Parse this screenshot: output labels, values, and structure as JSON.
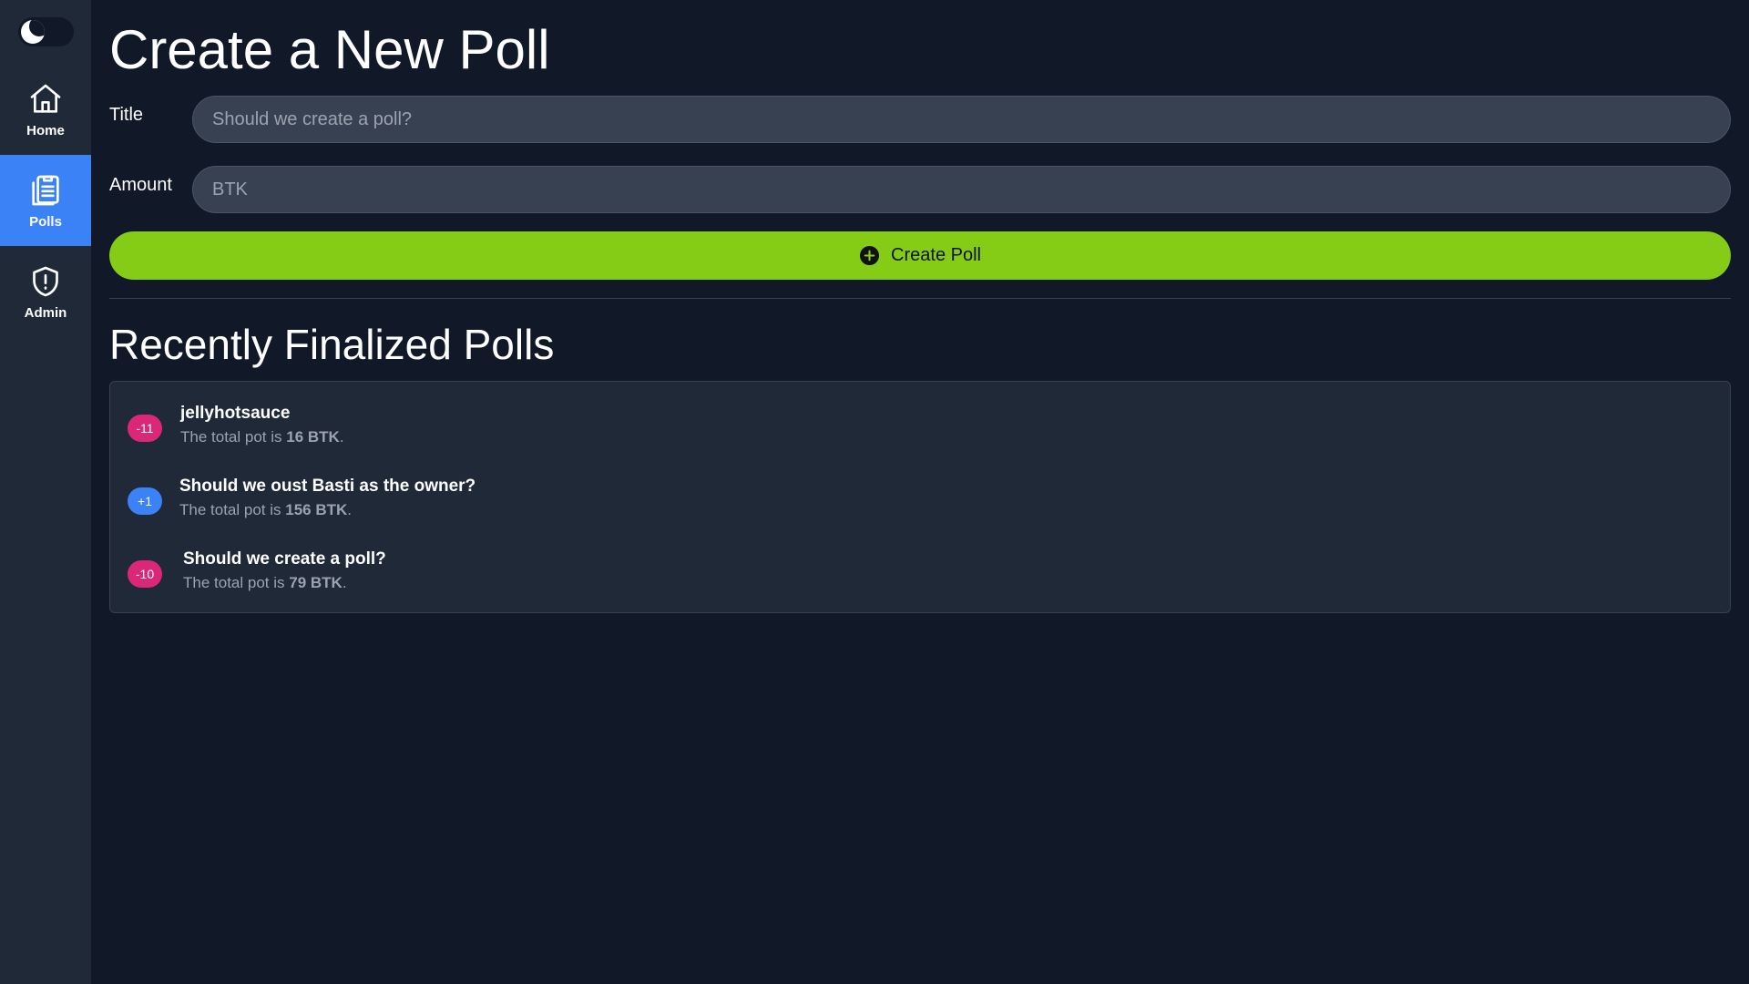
{
  "sidebar": {
    "theme_toggle": {
      "mode": "dark",
      "icon": "moon-icon"
    },
    "items": [
      {
        "label": "Home",
        "icon": "home-icon",
        "active": false
      },
      {
        "label": "Polls",
        "icon": "clipboard-icon",
        "active": true
      },
      {
        "label": "Admin",
        "icon": "shield-alert-icon",
        "active": false
      }
    ]
  },
  "main": {
    "title": "Create a New Poll",
    "form": {
      "title_label": "Title",
      "title_placeholder": "Should we create a poll?",
      "amount_label": "Amount",
      "amount_placeholder": "BTK",
      "submit_label": "Create Poll"
    },
    "recent_title": "Recently Finalized Polls",
    "polls": [
      {
        "badge": "-11",
        "badge_color": "#db2777",
        "title": "jellyhotsauce",
        "pot_prefix": "The total pot is ",
        "pot": "16 BTK",
        "pot_suffix": "."
      },
      {
        "badge": "+1",
        "badge_color": "#3b82f6",
        "title": "Should we oust Basti as the owner?",
        "pot_prefix": "The total pot is ",
        "pot": "156 BTK",
        "pot_suffix": "."
      },
      {
        "badge": "-10",
        "badge_color": "#db2777",
        "title": "Should we create a poll?",
        "pot_prefix": "The total pot is ",
        "pot": "79 BTK",
        "pot_suffix": "."
      }
    ]
  },
  "colors": {
    "background": "#111827",
    "sidebar": "#1f2937",
    "accent": "#3b82f6",
    "button": "#84cc16",
    "input": "#374151"
  }
}
